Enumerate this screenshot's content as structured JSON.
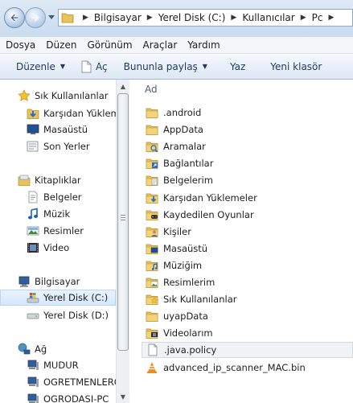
{
  "address_bar": {
    "breadcrumbs": [
      "Bilgisayar",
      "Yerel Disk (C:)",
      "Kullanıcılar",
      "Pc"
    ],
    "back_icon": "back-arrow-icon",
    "forward_icon": "forward-arrow-icon"
  },
  "menu": [
    "Dosya",
    "Düzen",
    "Görünüm",
    "Araçlar",
    "Yardım"
  ],
  "toolbar": {
    "organize": "Düzenle",
    "open": "Aç",
    "share": "Bununla paylaş",
    "burn": "Yaz",
    "new_folder": "Yeni klasör"
  },
  "nav": {
    "favorites": {
      "label": "Sık Kullanılanlar",
      "items": [
        "Karşıdan Yüklem",
        "Masaüstü",
        "Son Yerler"
      ]
    },
    "libraries": {
      "label": "Kitaplıklar",
      "items": [
        "Belgeler",
        "Müzik",
        "Resimler",
        "Video"
      ]
    },
    "computer": {
      "label": "Bilgisayar",
      "items": [
        "Yerel Disk (C:)",
        "Yerel Disk (D:)"
      ],
      "selected": "Yerel Disk (C:)"
    },
    "network": {
      "label": "Ağ",
      "items": [
        "MUDUR",
        "OGRETMENLERO",
        "OGRODASI-PC"
      ]
    }
  },
  "file_list": {
    "column_header": "Ad",
    "items": [
      {
        "name": ".android",
        "icon": "folder-icon"
      },
      {
        "name": "AppData",
        "icon": "folder-icon"
      },
      {
        "name": "Aramalar",
        "icon": "searches-folder-icon"
      },
      {
        "name": "Bağlantılar",
        "icon": "links-folder-icon"
      },
      {
        "name": "Belgelerim",
        "icon": "documents-folder-icon"
      },
      {
        "name": "Karşıdan Yüklemeler",
        "icon": "downloads-folder-icon"
      },
      {
        "name": "Kaydedilen Oyunlar",
        "icon": "saved-games-folder-icon"
      },
      {
        "name": "Kişiler",
        "icon": "contacts-folder-icon"
      },
      {
        "name": "Masaüstü",
        "icon": "desktop-folder-icon"
      },
      {
        "name": "Müziğim",
        "icon": "music-folder-icon"
      },
      {
        "name": "Resimlerim",
        "icon": "pictures-folder-icon"
      },
      {
        "name": "Sık Kullanılanlar",
        "icon": "favorites-folder-icon"
      },
      {
        "name": "uyapData",
        "icon": "folder-icon"
      },
      {
        "name": "Videolarım",
        "icon": "videos-folder-icon"
      },
      {
        "name": ".java.policy",
        "icon": "file-icon"
      },
      {
        "name": "advanced_ip_scanner_MAC.bin",
        "icon": "vlc-file-icon"
      }
    ],
    "selected": ".java.policy"
  },
  "colors": {
    "folder_yellow": "#e8c25a",
    "selection_blue": "#d5e7fb",
    "toolbar_text": "#1e395b"
  }
}
